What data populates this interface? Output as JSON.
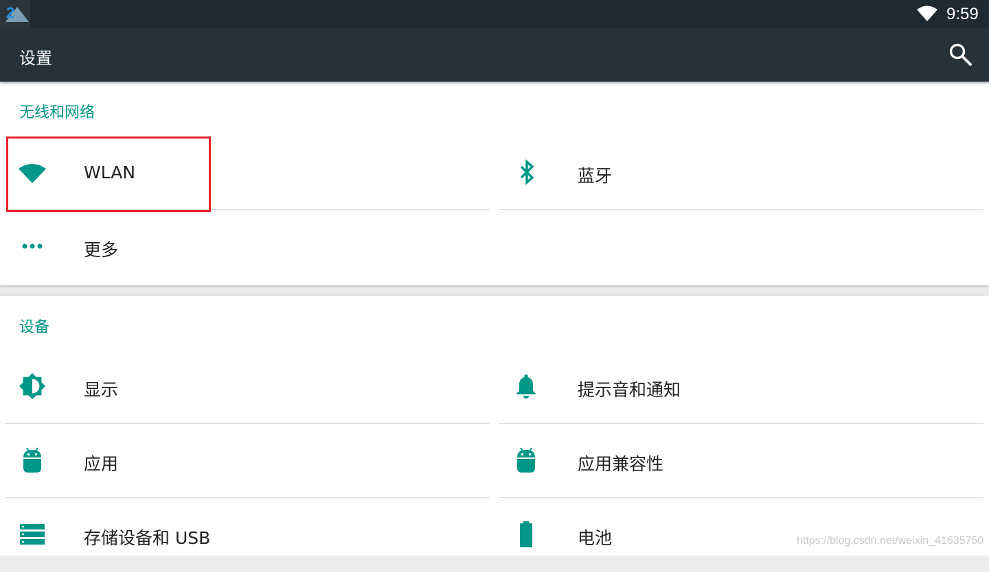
{
  "status_bar": {
    "app_icon_text": "2",
    "time": "9:59",
    "wifi_icon": "wifi-icon"
  },
  "app_bar": {
    "title": "设置",
    "search_icon": "search-icon"
  },
  "sections": [
    {
      "title": "无线和网络",
      "items": [
        {
          "label": "WLAN",
          "icon": "wifi-icon",
          "highlighted": true
        },
        {
          "label": "蓝牙",
          "icon": "bluetooth-icon"
        },
        {
          "label": "更多",
          "icon": "more-dots-icon"
        }
      ]
    },
    {
      "title": "设备",
      "items": [
        {
          "label": "显示",
          "icon": "brightness-icon"
        },
        {
          "label": "提示音和通知",
          "icon": "bell-icon"
        },
        {
          "label": "应用",
          "icon": "android-icon"
        },
        {
          "label": "应用兼容性",
          "icon": "android-icon"
        },
        {
          "label": "存储设备和 USB",
          "icon": "storage-icon"
        },
        {
          "label": "电池",
          "icon": "battery-icon"
        }
      ]
    }
  ],
  "watermark": "https://blog.csdn.net/weixin_41635750",
  "colors": {
    "accent": "#009688",
    "app_bar": "#263238",
    "status_bar": "#1f2a30",
    "highlight": "#e5242b"
  }
}
